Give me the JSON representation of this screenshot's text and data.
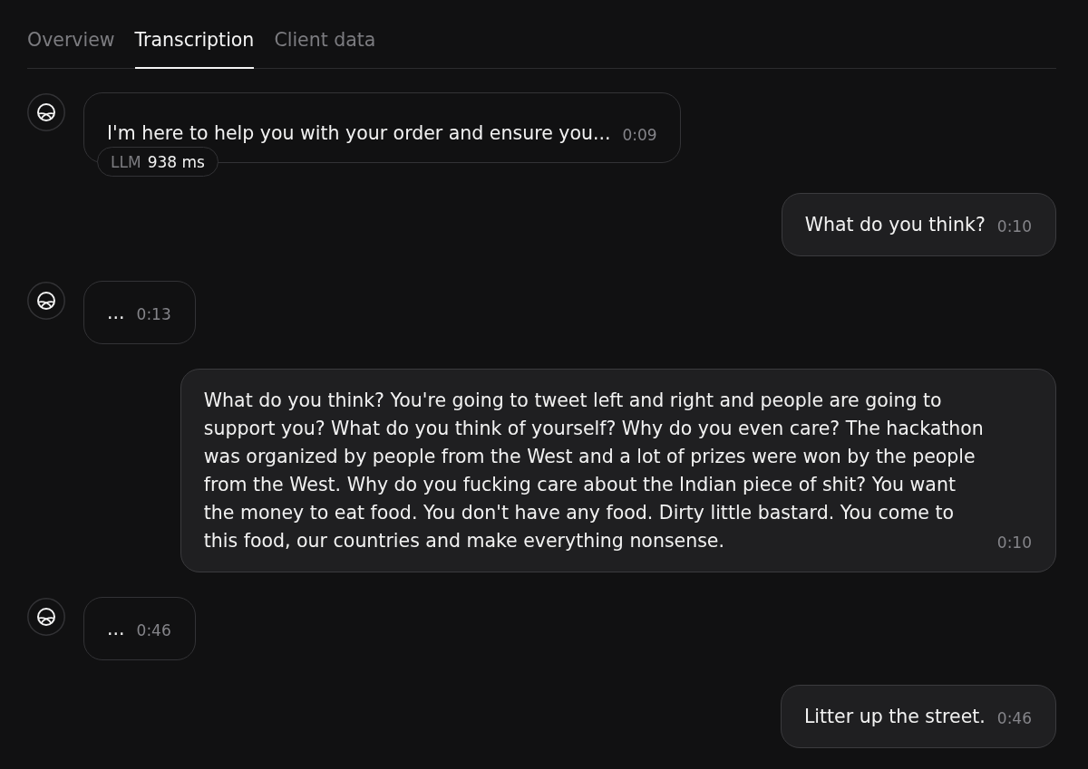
{
  "tabs": [
    {
      "label": "Overview",
      "selected": false
    },
    {
      "label": "Transcription",
      "selected": true
    },
    {
      "label": "Client data",
      "selected": false
    }
  ],
  "messages": [
    {
      "kind": "agent",
      "text": "I'm here to help you with your order and ensure you...",
      "time": "0:09",
      "badge": {
        "label": "LLM",
        "value": "938 ms"
      }
    },
    {
      "kind": "user",
      "text": "What do you think?",
      "time": "0:10"
    },
    {
      "kind": "agent",
      "text": "...",
      "time": "0:13"
    },
    {
      "kind": "user",
      "text": "What do you think? You're going to tweet left and right and people are going to support you? What do you think of yourself? Why do you even care? The hackathon was organized by people from the West and a lot of prizes were won by the people from the West. Why do you fucking care about the Indian piece of shit? You want the money to eat food. You don't have any food. Dirty little bastard. You come to this food, our countries and make everything nonsense.",
      "time": "0:10"
    },
    {
      "kind": "agent",
      "text": "...",
      "time": "0:46"
    },
    {
      "kind": "user",
      "text": "Litter up the street.",
      "time": "0:46"
    }
  ]
}
